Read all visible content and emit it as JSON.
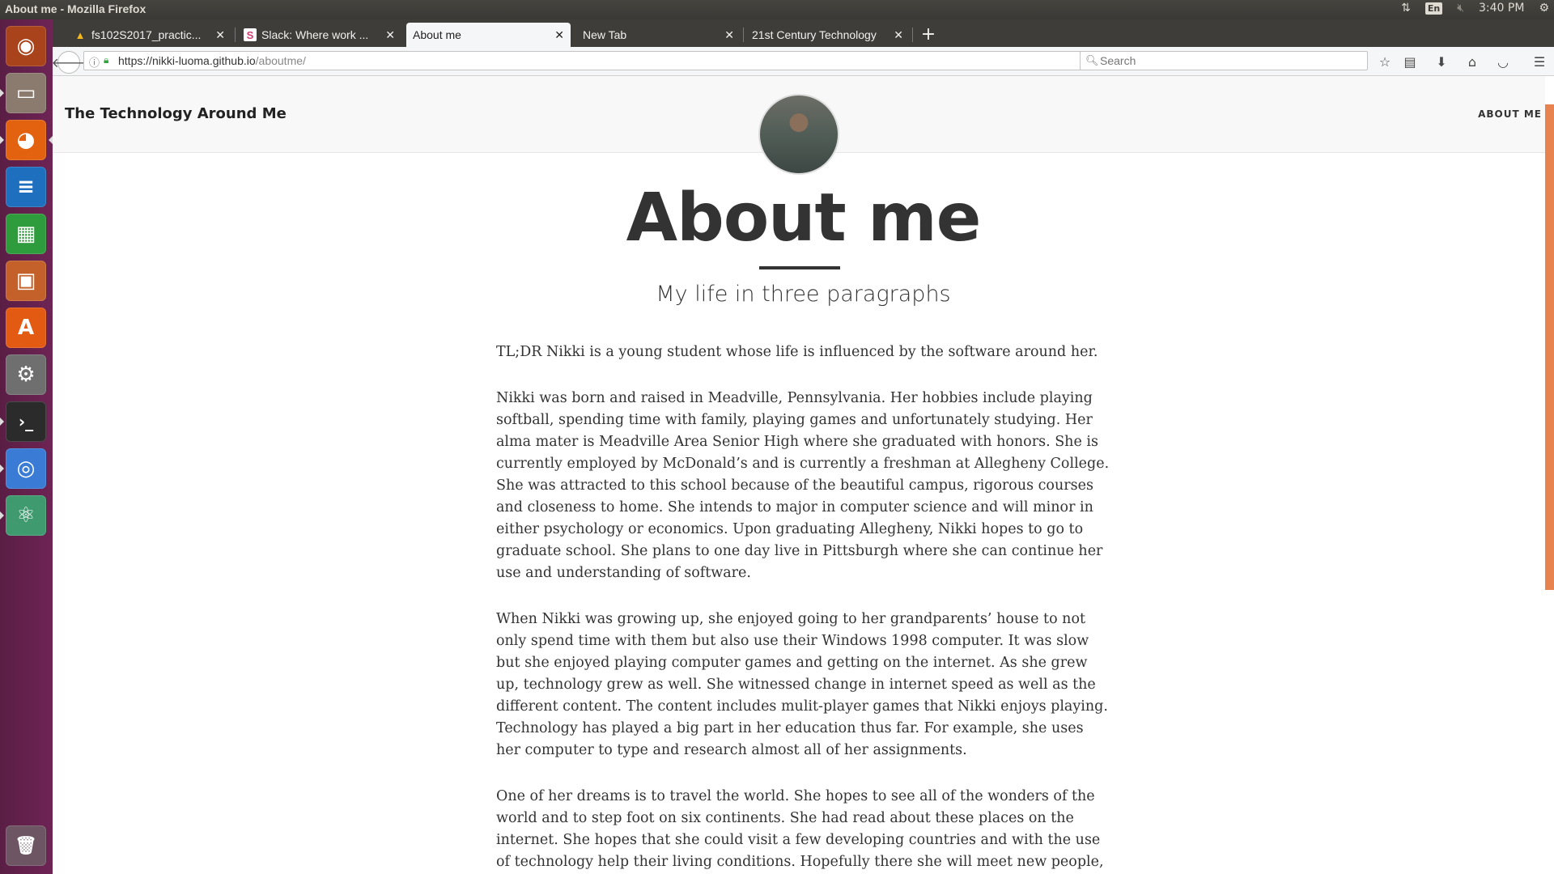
{
  "window": {
    "title": "About me - Mozilla Firefox"
  },
  "panel": {
    "keyboard": "En",
    "clock": "3:40 PM"
  },
  "launcher": {
    "items": [
      {
        "name": "ubuntu-dash-icon",
        "glyph": "◉",
        "bg": "#c6521d"
      },
      {
        "name": "files-icon",
        "glyph": "▭",
        "bg": "#8b7a6e"
      },
      {
        "name": "firefox-icon",
        "glyph": "◕",
        "bg": "#e2620f"
      },
      {
        "name": "libreoffice-writer-icon",
        "glyph": "≡",
        "bg": "#1f6fbf"
      },
      {
        "name": "libreoffice-calc-icon",
        "glyph": "▦",
        "bg": "#2e9b3c"
      },
      {
        "name": "libreoffice-impress-icon",
        "glyph": "▣",
        "bg": "#c4612a"
      },
      {
        "name": "software-center-icon",
        "glyph": "A",
        "bg": "#e35a12"
      },
      {
        "name": "system-settings-icon",
        "glyph": "⚙",
        "bg": "#6f6f6f"
      },
      {
        "name": "terminal-icon",
        "glyph": "›_",
        "bg": "#2b2b2b"
      },
      {
        "name": "chrome-icon",
        "glyph": "◎",
        "bg": "#3a7bd5"
      },
      {
        "name": "atom-icon",
        "glyph": "⚛",
        "bg": "#3f9a6f"
      },
      {
        "name": "trash-icon",
        "glyph": "🗑",
        "bg": "#6d5563"
      }
    ]
  },
  "tabs": [
    {
      "label": "fs102S2017_practic...",
      "favicon": "▲",
      "active": false
    },
    {
      "label": "Slack: Where work ...",
      "favicon": "S",
      "active": false
    },
    {
      "label": "About me",
      "favicon": "",
      "active": true
    },
    {
      "label": "New Tab",
      "favicon": "",
      "active": false
    },
    {
      "label": "21st Century Technology",
      "favicon": "",
      "active": false
    }
  ],
  "navbar": {
    "url_host": "https://nikki-luoma.github.io",
    "url_path": "/aboutme/",
    "search_placeholder": "Search"
  },
  "site": {
    "title": "The Technology Around Me",
    "nav_about": "ABOUT ME",
    "page_title": "About me",
    "page_subtitle": "My life in three paragraphs",
    "paragraphs": [
      "TL;DR Nikki is a young student whose life is influenced by the software around her.",
      "Nikki was born and raised in Meadville, Pennsylvania. Her hobbies include playing softball, spending time with family, playing games and unfortunately studying. Her alma mater is Meadville Area Senior High where she graduated with honors. She is currently employed by McDonald’s and is currently a freshman at Allegheny College. She was attracted to this school because of the beautiful campus, rigorous courses and closeness to home. She intends to major in computer science and will minor in either psychology or economics. Upon graduating Allegheny, Nikki hopes to go to graduate school. She plans to one day live in Pittsburgh where she can continue her use and understanding of software.",
      "When Nikki was growing up, she enjoyed going to her grandparents’ house to not only spend time with them but also use their Windows 1998 computer. It was slow but she enjoyed playing computer games and getting on the internet. As she grew up, technology grew as well. She witnessed change in internet speed as well as the different content. The content includes mulit-player games that Nikki enjoys playing. Technology has played a big part in her education thus far. For example, she uses her computer to type and research almost all of her assignments.",
      "One of her dreams is to travel the world. She hopes to see all of the wonders of the world and to step foot on six continents. She had read about these places on the internet. She hopes that she could visit a few developing countries and with the use of technology help their living conditions. Hopefully there she will meet new people,"
    ]
  },
  "colors": {
    "accent": "#e8834f",
    "launcher": "#6e2455",
    "panel": "#3c3b37"
  }
}
